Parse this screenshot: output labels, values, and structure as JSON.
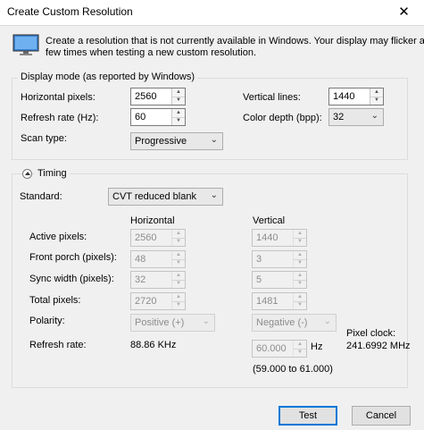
{
  "window": {
    "title": "Create Custom Resolution",
    "close_label": "✕"
  },
  "intro": {
    "line1": "Create a resolution that is not currently available in Windows. Your display may flicker a",
    "line2": "few times when testing a new custom resolution."
  },
  "display_mode": {
    "group_title": "Display mode (as reported by Windows)",
    "horizontal_pixels_label": "Horizontal pixels:",
    "horizontal_pixels_value": "2560",
    "vertical_lines_label": "Vertical lines:",
    "vertical_lines_value": "1440",
    "refresh_rate_label": "Refresh rate (Hz):",
    "refresh_rate_value": "60",
    "color_depth_label": "Color depth (bpp):",
    "color_depth_value": "32",
    "scan_type_label": "Scan type:",
    "scan_type_value": "Progressive"
  },
  "timing": {
    "group_title": "Timing",
    "standard_label": "Standard:",
    "standard_value": "CVT reduced blank",
    "col_horizontal": "Horizontal",
    "col_vertical": "Vertical",
    "rows": {
      "active_label": "Active pixels:",
      "active_h": "2560",
      "active_v": "1440",
      "front_label": "Front porch (pixels):",
      "front_h": "48",
      "front_v": "3",
      "sync_label": "Sync width (pixels):",
      "sync_h": "32",
      "sync_v": "5",
      "total_label": "Total pixels:",
      "total_h": "2720",
      "total_v": "1481",
      "polarity_label": "Polarity:",
      "polarity_h": "Positive (+)",
      "polarity_v": "Negative (-)",
      "refresh_label": "Refresh rate:",
      "refresh_h": "88.86 KHz",
      "refresh_v": "60.000",
      "refresh_v_unit": "Hz",
      "refresh_range": "(59.000 to 61.000)"
    },
    "pixel_clock_label": "Pixel clock:",
    "pixel_clock_value": "241.6992 MHz"
  },
  "buttons": {
    "test": "Test",
    "cancel": "Cancel"
  }
}
